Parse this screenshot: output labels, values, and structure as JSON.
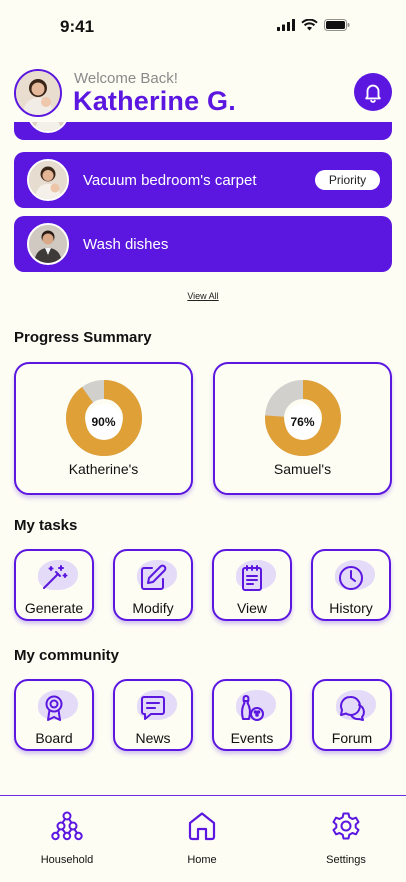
{
  "status": {
    "time": "9:41"
  },
  "header": {
    "welcome": "Welcome Back!",
    "name": "Katherine G."
  },
  "tasks": [
    {
      "label": "Vacuum bedroom's carpet",
      "badge": "Priority"
    },
    {
      "label": "Wash dishes"
    }
  ],
  "view_all": "View All",
  "progress": {
    "title": "Progress Summary",
    "items": [
      {
        "name": "Katherine's",
        "value": 90,
        "label": "90%"
      },
      {
        "name": "Samuel's",
        "value": 76,
        "label": "76%"
      }
    ],
    "colors": {
      "fill": "#e0a038",
      "rest": "#d2d0cc"
    }
  },
  "my_tasks": {
    "title": "My tasks",
    "items": [
      {
        "label": "Generate",
        "icon": "magic-wand-icon"
      },
      {
        "label": "Modify",
        "icon": "edit-icon"
      },
      {
        "label": "View",
        "icon": "document-icon"
      },
      {
        "label": "History",
        "icon": "clock-icon"
      }
    ]
  },
  "community": {
    "title": "My community",
    "items": [
      {
        "label": "Board",
        "icon": "award-icon"
      },
      {
        "label": "News",
        "icon": "message-icon"
      },
      {
        "label": "Events",
        "icon": "bowling-icon"
      },
      {
        "label": "Forum",
        "icon": "chat-bubbles-icon"
      }
    ]
  },
  "nav": [
    {
      "label": "Household",
      "icon": "household-icon"
    },
    {
      "label": "Home",
      "icon": "home-icon"
    },
    {
      "label": "Settings",
      "icon": "settings-icon"
    }
  ],
  "theme": {
    "accent": "#5b17e0",
    "background": "#fdfdf4"
  }
}
